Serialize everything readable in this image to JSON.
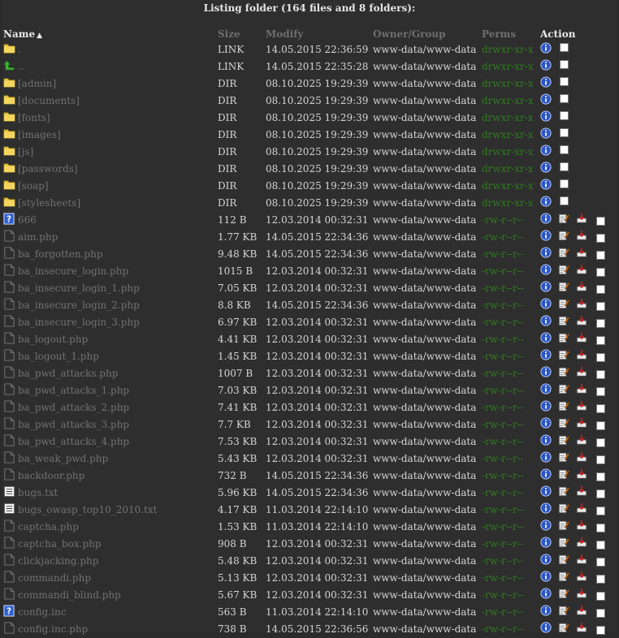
{
  "title": "Listing folder (164 files and 8 folders):",
  "headers": {
    "name": "Name",
    "sort_arrow": "▲",
    "size": "Size",
    "modify": "Modify",
    "owner": "Owner/Group",
    "perms": "Perms",
    "action": "Action"
  },
  "rows": [
    {
      "type": "folder",
      "name": ".",
      "size": "LINK",
      "modify": "14.05.2015 22:36:59",
      "owner": "www-data/www-data",
      "perms": "drwxr-xr-x"
    },
    {
      "type": "up",
      "name": "..",
      "size": "LINK",
      "modify": "14.05.2015 22:35:28",
      "owner": "www-data/www-data",
      "perms": "drwxr-xr-x"
    },
    {
      "type": "folder",
      "name": "[admin]",
      "size": "DIR",
      "modify": "08.10.2025 19:29:39",
      "owner": "www-data/www-data",
      "perms": "drwxr-xr-x"
    },
    {
      "type": "folder",
      "name": "[documents]",
      "size": "DIR",
      "modify": "08.10.2025 19:29:39",
      "owner": "www-data/www-data",
      "perms": "drwxr-xr-x"
    },
    {
      "type": "folder",
      "name": "[fonts]",
      "size": "DIR",
      "modify": "08.10.2025 19:29:39",
      "owner": "www-data/www-data",
      "perms": "drwxr-xr-x"
    },
    {
      "type": "folder",
      "name": "[images]",
      "size": "DIR",
      "modify": "08.10.2025 19:29:39",
      "owner": "www-data/www-data",
      "perms": "drwxr-xr-x"
    },
    {
      "type": "folder",
      "name": "[js]",
      "size": "DIR",
      "modify": "08.10.2025 19:29:39",
      "owner": "www-data/www-data",
      "perms": "drwxr-xr-x"
    },
    {
      "type": "folder",
      "name": "[passwords]",
      "size": "DIR",
      "modify": "08.10.2025 19:29:39",
      "owner": "www-data/www-data",
      "perms": "drwxr-xr-x"
    },
    {
      "type": "folder",
      "name": "[soap]",
      "size": "DIR",
      "modify": "08.10.2025 19:29:39",
      "owner": "www-data/www-data",
      "perms": "drwxr-xr-x"
    },
    {
      "type": "folder",
      "name": "[stylesheets]",
      "size": "DIR",
      "modify": "08.10.2025 19:29:39",
      "owner": "www-data/www-data",
      "perms": "drwxr-xr-x"
    },
    {
      "type": "unknown",
      "name": "666",
      "size": "112 B",
      "modify": "12.03.2014 00:32:31",
      "owner": "www-data/www-data",
      "perms": "-rw-r--r--"
    },
    {
      "type": "php",
      "name": "aim.php",
      "size": "1.77 KB",
      "modify": "14.05.2015 22:34:36",
      "owner": "www-data/www-data",
      "perms": "-rw-r--r--"
    },
    {
      "type": "php",
      "name": "ba_forgotten.php",
      "size": "9.48 KB",
      "modify": "14.05.2015 22:34:36",
      "owner": "www-data/www-data",
      "perms": "-rw-r--r--"
    },
    {
      "type": "php",
      "name": "ba_insecure_login.php",
      "size": "1015 B",
      "modify": "12.03.2014 00:32:31",
      "owner": "www-data/www-data",
      "perms": "-rw-r--r--"
    },
    {
      "type": "php",
      "name": "ba_insecure_login_1.php",
      "size": "7.05 KB",
      "modify": "12.03.2014 00:32:31",
      "owner": "www-data/www-data",
      "perms": "-rw-r--r--"
    },
    {
      "type": "php",
      "name": "ba_insecure_login_2.php",
      "size": "8.8 KB",
      "modify": "14.05.2015 22:34:36",
      "owner": "www-data/www-data",
      "perms": "-rw-r--r--"
    },
    {
      "type": "php",
      "name": "ba_insecure_login_3.php",
      "size": "6.97 KB",
      "modify": "12.03.2014 00:32:31",
      "owner": "www-data/www-data",
      "perms": "-rw-r--r--"
    },
    {
      "type": "php",
      "name": "ba_logout.php",
      "size": "4.41 KB",
      "modify": "12.03.2014 00:32:31",
      "owner": "www-data/www-data",
      "perms": "-rw-r--r--"
    },
    {
      "type": "php",
      "name": "ba_logout_1.php",
      "size": "1.45 KB",
      "modify": "12.03.2014 00:32:31",
      "owner": "www-data/www-data",
      "perms": "-rw-r--r--"
    },
    {
      "type": "php",
      "name": "ba_pwd_attacks.php",
      "size": "1007 B",
      "modify": "12.03.2014 00:32:31",
      "owner": "www-data/www-data",
      "perms": "-rw-r--r--"
    },
    {
      "type": "php",
      "name": "ba_pwd_attacks_1.php",
      "size": "7.03 KB",
      "modify": "12.03.2014 00:32:31",
      "owner": "www-data/www-data",
      "perms": "-rw-r--r--"
    },
    {
      "type": "php",
      "name": "ba_pwd_attacks_2.php",
      "size": "7.41 KB",
      "modify": "12.03.2014 00:32:31",
      "owner": "www-data/www-data",
      "perms": "-rw-r--r--"
    },
    {
      "type": "php",
      "name": "ba_pwd_attacks_3.php",
      "size": "7.7 KB",
      "modify": "12.03.2014 00:32:31",
      "owner": "www-data/www-data",
      "perms": "-rw-r--r--"
    },
    {
      "type": "php",
      "name": "ba_pwd_attacks_4.php",
      "size": "7.53 KB",
      "modify": "12.03.2014 00:32:31",
      "owner": "www-data/www-data",
      "perms": "-rw-r--r--"
    },
    {
      "type": "php",
      "name": "ba_weak_pwd.php",
      "size": "5.43 KB",
      "modify": "12.03.2014 00:32:31",
      "owner": "www-data/www-data",
      "perms": "-rw-r--r--"
    },
    {
      "type": "php",
      "name": "backdoor.php",
      "size": "732 B",
      "modify": "14.05.2015 22:34:36",
      "owner": "www-data/www-data",
      "perms": "-rw-r--r--"
    },
    {
      "type": "txt",
      "name": "bugs.txt",
      "size": "5.96 KB",
      "modify": "14.05.2015 22:34:36",
      "owner": "www-data/www-data",
      "perms": "-rw-r--r--"
    },
    {
      "type": "txt",
      "name": "bugs_owasp_top10_2010.txt",
      "size": "4.17 KB",
      "modify": "11.03.2014 22:14:10",
      "owner": "www-data/www-data",
      "perms": "-rw-r--r--"
    },
    {
      "type": "php",
      "name": "captcha.php",
      "size": "1.53 KB",
      "modify": "11.03.2014 22:14:10",
      "owner": "www-data/www-data",
      "perms": "-rw-r--r--"
    },
    {
      "type": "php",
      "name": "captcha_box.php",
      "size": "908 B",
      "modify": "12.03.2014 00:32:31",
      "owner": "www-data/www-data",
      "perms": "-rw-r--r--"
    },
    {
      "type": "php",
      "name": "clickjacking.php",
      "size": "5.48 KB",
      "modify": "12.03.2014 00:32:31",
      "owner": "www-data/www-data",
      "perms": "-rw-r--r--"
    },
    {
      "type": "php",
      "name": "commandi.php",
      "size": "5.13 KB",
      "modify": "12.03.2014 00:32:31",
      "owner": "www-data/www-data",
      "perms": "-rw-r--r--"
    },
    {
      "type": "php",
      "name": "commandi_blind.php",
      "size": "5.67 KB",
      "modify": "12.03.2014 00:32:31",
      "owner": "www-data/www-data",
      "perms": "-rw-r--r--"
    },
    {
      "type": "unknown",
      "name": "config.inc",
      "size": "563 B",
      "modify": "11.03.2014 22:14:10",
      "owner": "www-data/www-data",
      "perms": "-rw-r--r--"
    },
    {
      "type": "php",
      "name": "config.inc.php",
      "size": "738 B",
      "modify": "14.05.2015 22:36:56",
      "owner": "www-data/www-data",
      "perms": "-rw-r--r--"
    }
  ],
  "colors": {
    "background": "#2b2b2b",
    "name_text": "#727272",
    "perm_text": "#2f7d1f",
    "header_dim": "#6f6f6f"
  }
}
